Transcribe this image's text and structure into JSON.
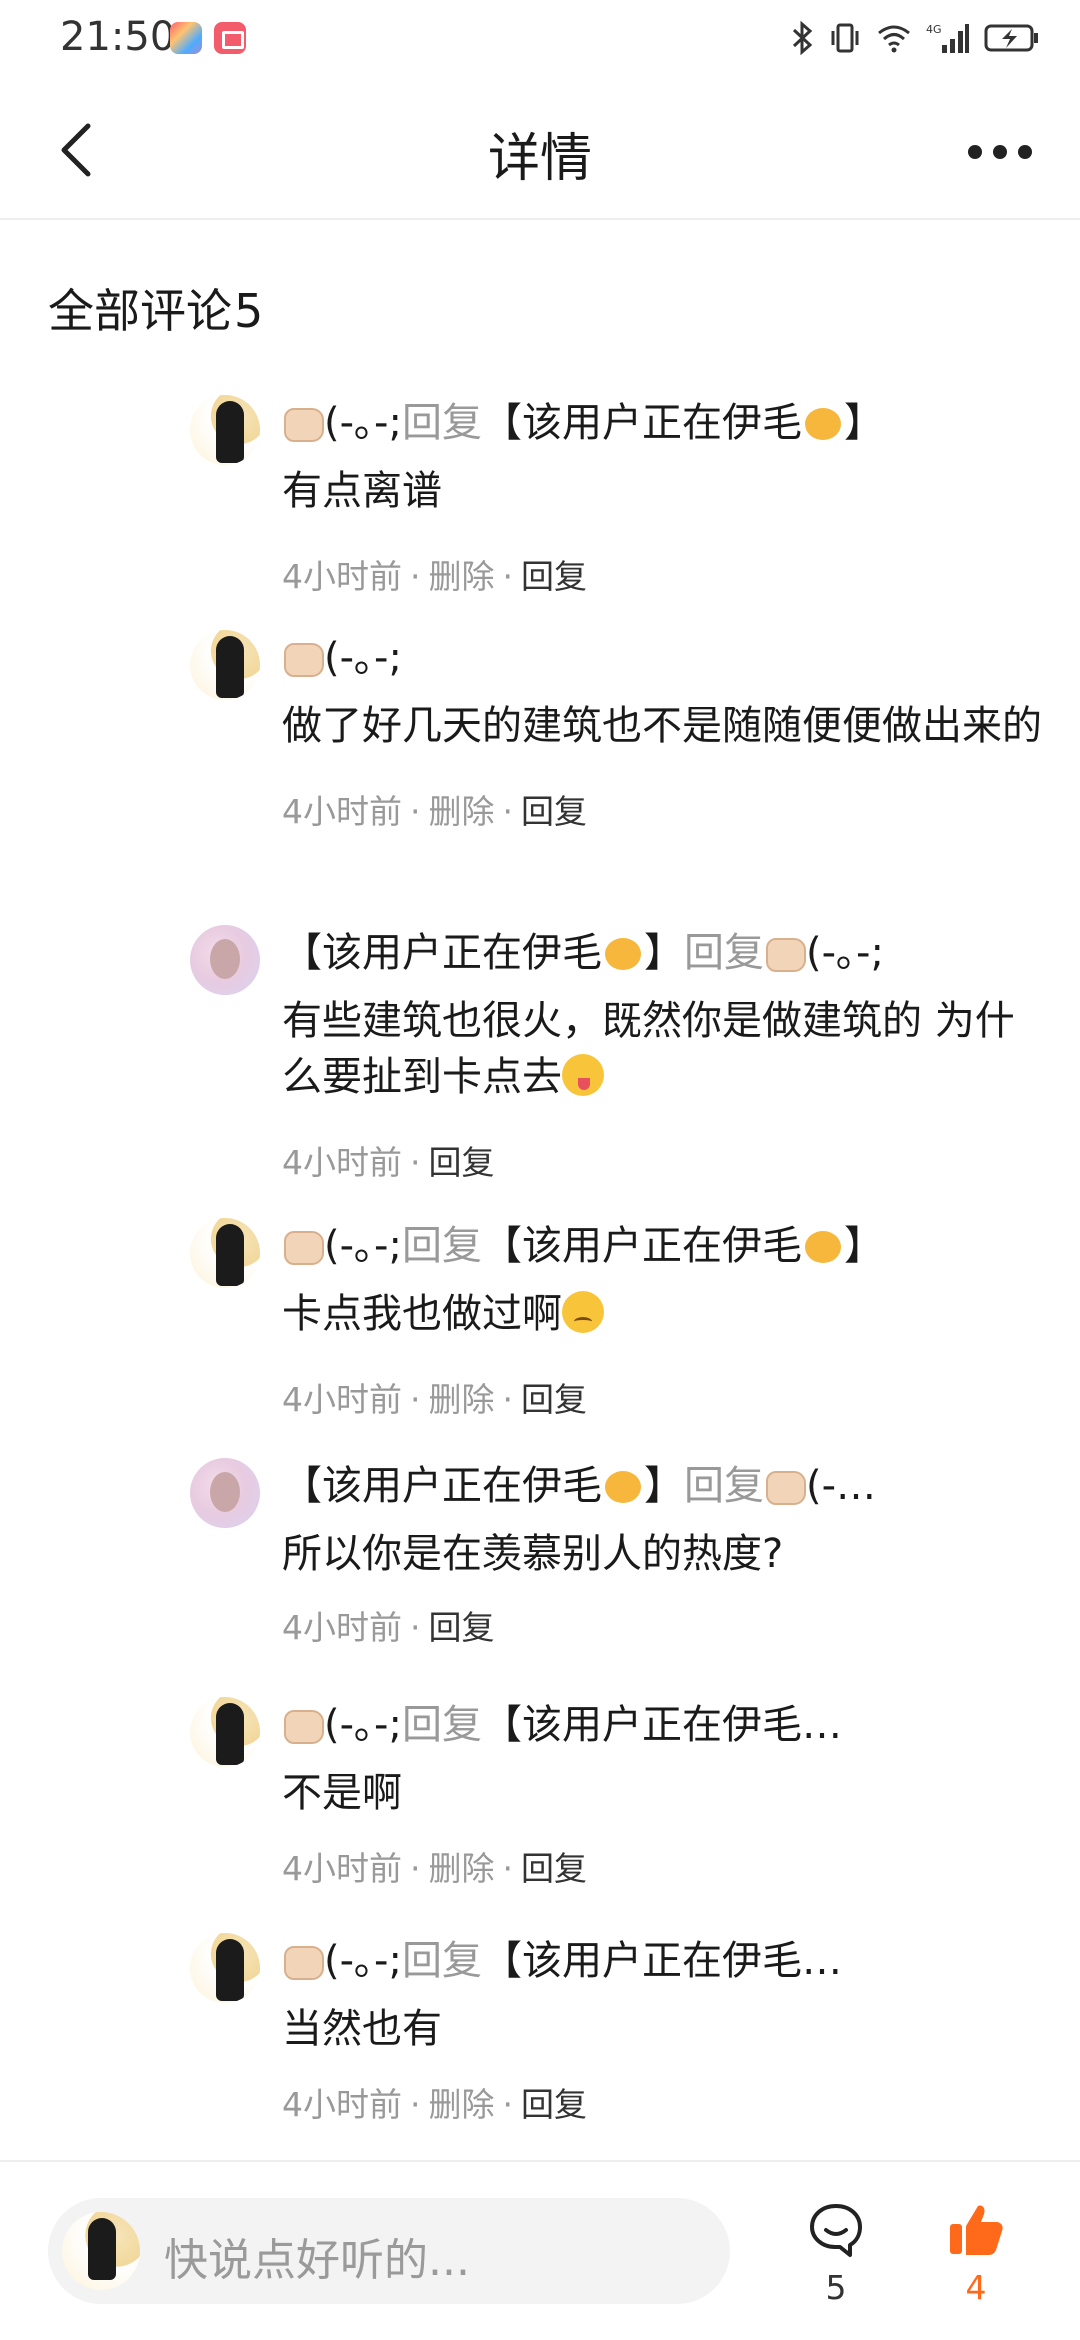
{
  "status_bar": {
    "time": "21:50",
    "icons": [
      "bluetooth-icon",
      "vibrate-icon",
      "wifi-icon",
      "4g-signal-icon",
      "battery-charging-icon"
    ]
  },
  "header": {
    "title": "详情",
    "back_icon": "chevron-left-icon",
    "more_icon": "more-dots-icon"
  },
  "comments_section": {
    "title": "全部评论",
    "count": "5"
  },
  "comments": [
    {
      "author": "(-｡-;",
      "reply_word": "回复",
      "target": "【该用户正在伊毛",
      "target_suffix": "】",
      "text": "有点离谱",
      "time": "4小时前",
      "dot": "·",
      "delete": "删除",
      "reply": "回复",
      "avatar": "dark"
    },
    {
      "author": "(-｡-;",
      "text": "做了好几天的建筑也不是随随便便做出来的",
      "time": "4小时前",
      "dot": "·",
      "delete": "删除",
      "reply": "回复",
      "avatar": "dark"
    },
    {
      "author": "【该用户正在伊毛",
      "author_suffix": "】",
      "reply_word": "回复",
      "target": "(-｡-;",
      "text": "有些建筑也很火，既然你是做建筑的 为什么要扯到卡点去",
      "time": "4小时前",
      "dot": "·",
      "reply": "回复",
      "avatar": "pink"
    },
    {
      "author": "(-｡-;",
      "reply_word": "回复",
      "target": "【该用户正在伊毛",
      "target_suffix": "】",
      "text": "卡点我也做过啊",
      "time": "4小时前",
      "dot": "·",
      "delete": "删除",
      "reply": "回复",
      "avatar": "dark"
    },
    {
      "author": "【该用户正在伊毛",
      "author_suffix": "】",
      "reply_word": "回复",
      "target": "(-…",
      "text": "所以你是在羡慕别人的热度?",
      "time": "4小时前",
      "dot": "·",
      "reply": "回复",
      "avatar": "pink"
    },
    {
      "author": "(-｡-;",
      "reply_word": "回复",
      "target": "【该用户正在伊毛…",
      "text": "不是啊",
      "time": "4小时前",
      "dot": "·",
      "delete": "删除",
      "reply": "回复",
      "avatar": "dark"
    },
    {
      "author": "(-｡-;",
      "reply_word": "回复",
      "target": "【该用户正在伊毛…",
      "text": "当然也有",
      "time": "4小时前",
      "dot": "·",
      "delete": "删除",
      "reply": "回复",
      "avatar": "dark"
    }
  ],
  "bottom_bar": {
    "input_placeholder": "快说点好听的...",
    "comment_count": "5",
    "like_count": "4",
    "accent_color": "#ff6a1a"
  }
}
